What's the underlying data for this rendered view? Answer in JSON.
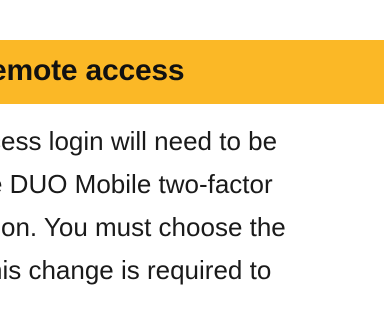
{
  "notice": {
    "title": "emote access",
    "accent_color": "#FBB826",
    "body_lines": [
      "cess login will need to be",
      "e DUO Mobile two-factor",
      "tion. You must choose the",
      "his change is required to"
    ]
  }
}
